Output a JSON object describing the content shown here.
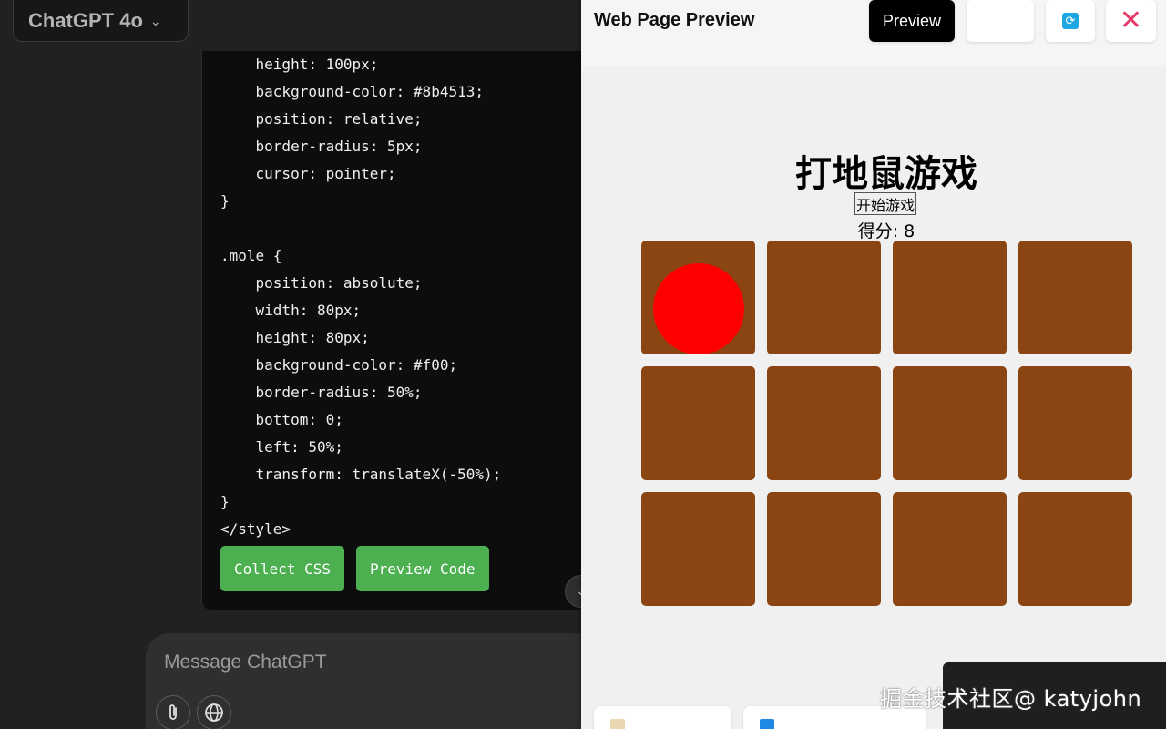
{
  "chatgpt": {
    "model_label": "ChatGPT 4o",
    "code_lines": [
      "    height: 100px;",
      "    background-color: #8b4513;",
      "    position: relative;",
      "    border-radius: 5px;",
      "    cursor: pointer;",
      "}",
      "",
      ".mole {",
      "    position: absolute;",
      "    width: 80px;",
      "    height: 80px;",
      "    background-color: #f00;",
      "    border-radius: 50%;",
      "    bottom: 0;",
      "    left: 50%;",
      "    transform: translateX(-50%);",
      "}",
      "</style>"
    ],
    "collect_css_label": "Collect CSS",
    "preview_code_label": "Preview Code",
    "composer_placeholder": "Message ChatGPT",
    "accent_green": "#4caf50"
  },
  "preview": {
    "panel_title": "Web Page Preview",
    "preview_button_label": "Preview",
    "game": {
      "title": "打地鼠游戏",
      "start_button_label": "开始游戏",
      "score_text": "得分: 8",
      "hole_color": "#8b4513",
      "mole_color": "#ff0000",
      "rows": 3,
      "cols": 4,
      "active_mole_index": 0
    }
  },
  "watermark": "掘金技术社区@ katyjohn"
}
